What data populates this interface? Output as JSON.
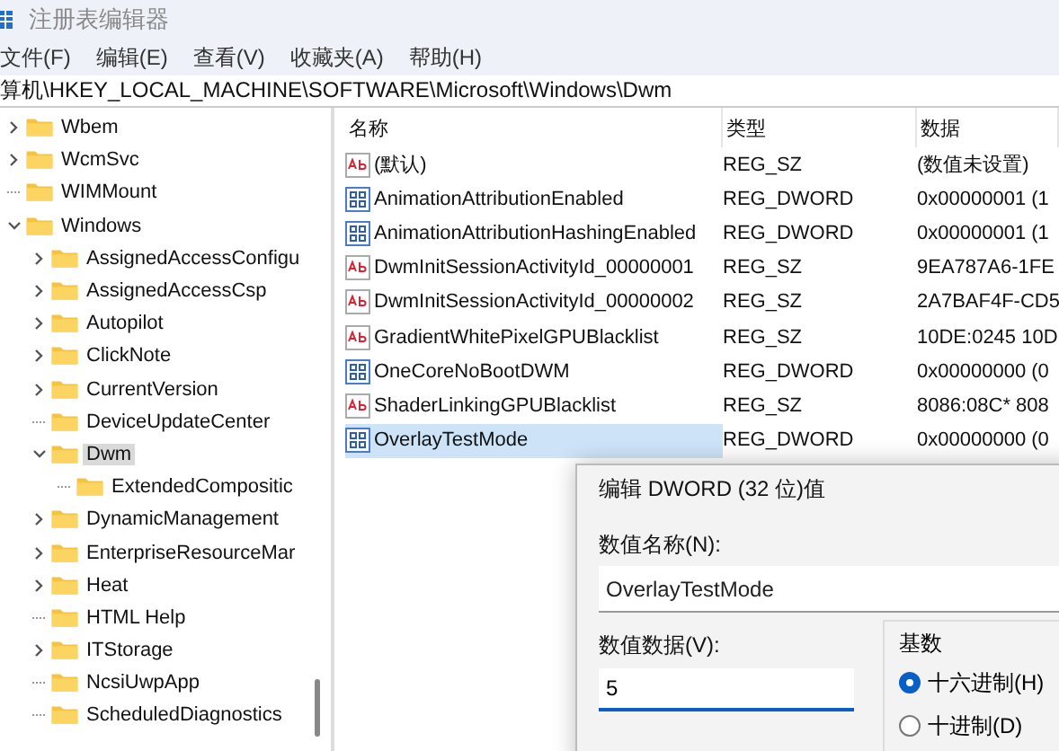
{
  "window": {
    "title": "注册表编辑器"
  },
  "menu": [
    "文件(F)",
    "编辑(E)",
    "查看(V)",
    "收藏夹(A)",
    "帮助(H)"
  ],
  "address": "算机\\HKEY_LOCAL_MACHINE\\SOFTWARE\\Microsoft\\Windows\\Dwm",
  "tree": [
    {
      "label": "Wbem",
      "kind": "branch",
      "expanded": false,
      "selected": false
    },
    {
      "label": "WcmSvc",
      "kind": "branch",
      "expanded": false,
      "selected": false
    },
    {
      "label": "WIMMount",
      "kind": "leaf",
      "selected": false
    },
    {
      "label": "Windows",
      "kind": "branch",
      "expanded": true,
      "selected": false,
      "children": [
        {
          "label": "AssignedAccessConfigu",
          "kind": "branch",
          "expanded": false,
          "selected": false
        },
        {
          "label": "AssignedAccessCsp",
          "kind": "branch",
          "expanded": false,
          "selected": false
        },
        {
          "label": "Autopilot",
          "kind": "branch",
          "expanded": false,
          "selected": false
        },
        {
          "label": "ClickNote",
          "kind": "branch",
          "expanded": false,
          "selected": false
        },
        {
          "label": "CurrentVersion",
          "kind": "branch",
          "expanded": false,
          "selected": false
        },
        {
          "label": "DeviceUpdateCenter",
          "kind": "leaf",
          "selected": false
        },
        {
          "label": "Dwm",
          "kind": "branch",
          "expanded": true,
          "selected": true,
          "children": [
            {
              "label": "ExtendedCompositic",
              "kind": "leaf",
              "selected": false
            }
          ]
        },
        {
          "label": "DynamicManagement",
          "kind": "branch",
          "expanded": false,
          "selected": false
        },
        {
          "label": "EnterpriseResourceMar",
          "kind": "branch",
          "expanded": false,
          "selected": false
        },
        {
          "label": "Heat",
          "kind": "branch",
          "expanded": false,
          "selected": false
        },
        {
          "label": "HTML Help",
          "kind": "leaf",
          "selected": false
        },
        {
          "label": "ITStorage",
          "kind": "branch",
          "expanded": false,
          "selected": false
        },
        {
          "label": "NcsiUwpApp",
          "kind": "leaf",
          "selected": false
        },
        {
          "label": "ScheduledDiagnostics",
          "kind": "leaf",
          "selected": false
        }
      ]
    }
  ],
  "table": {
    "columns": [
      "名称",
      "类型",
      "数据"
    ],
    "rows": [
      {
        "kind": "sz",
        "name": "(默认)",
        "type": "REG_SZ",
        "data": "(数值未设置)",
        "selected": false
      },
      {
        "kind": "dword",
        "name": "AnimationAttributionEnabled",
        "type": "REG_DWORD",
        "data": "0x00000001 (1",
        "selected": false
      },
      {
        "kind": "dword",
        "name": "AnimationAttributionHashingEnabled",
        "type": "REG_DWORD",
        "data": "0x00000001 (1",
        "selected": false
      },
      {
        "kind": "sz",
        "name": "DwmInitSessionActivityId_00000001",
        "type": "REG_SZ",
        "data": "9EA787A6-1FE",
        "selected": false
      },
      {
        "kind": "sz",
        "name": "DwmInitSessionActivityId_00000002",
        "type": "REG_SZ",
        "data": "2A7BAF4F-CD5",
        "selected": false
      },
      {
        "kind": "sz",
        "name": "GradientWhitePixelGPUBlacklist",
        "type": "REG_SZ",
        "data": "10DE:0245 10D",
        "selected": false
      },
      {
        "kind": "dword",
        "name": "OneCoreNoBootDWM",
        "type": "REG_DWORD",
        "data": "0x00000000 (0",
        "selected": false
      },
      {
        "kind": "sz",
        "name": "ShaderLinkingGPUBlacklist",
        "type": "REG_SZ",
        "data": "8086:08C* 808",
        "selected": false
      },
      {
        "kind": "dword",
        "name": "OverlayTestMode",
        "type": "REG_DWORD",
        "data": "0x00000000 (0",
        "selected": true
      }
    ]
  },
  "dialog": {
    "title": "编辑 DWORD (32 位)值",
    "name_label": "数值名称(N):",
    "name_value": "OverlayTestMode",
    "data_label": "数值数据(V):",
    "data_value": "5",
    "base_title": "基数",
    "base_options": [
      {
        "label": "十六进制(H)",
        "selected": true
      },
      {
        "label": "十进制(D)",
        "selected": false
      }
    ]
  }
}
